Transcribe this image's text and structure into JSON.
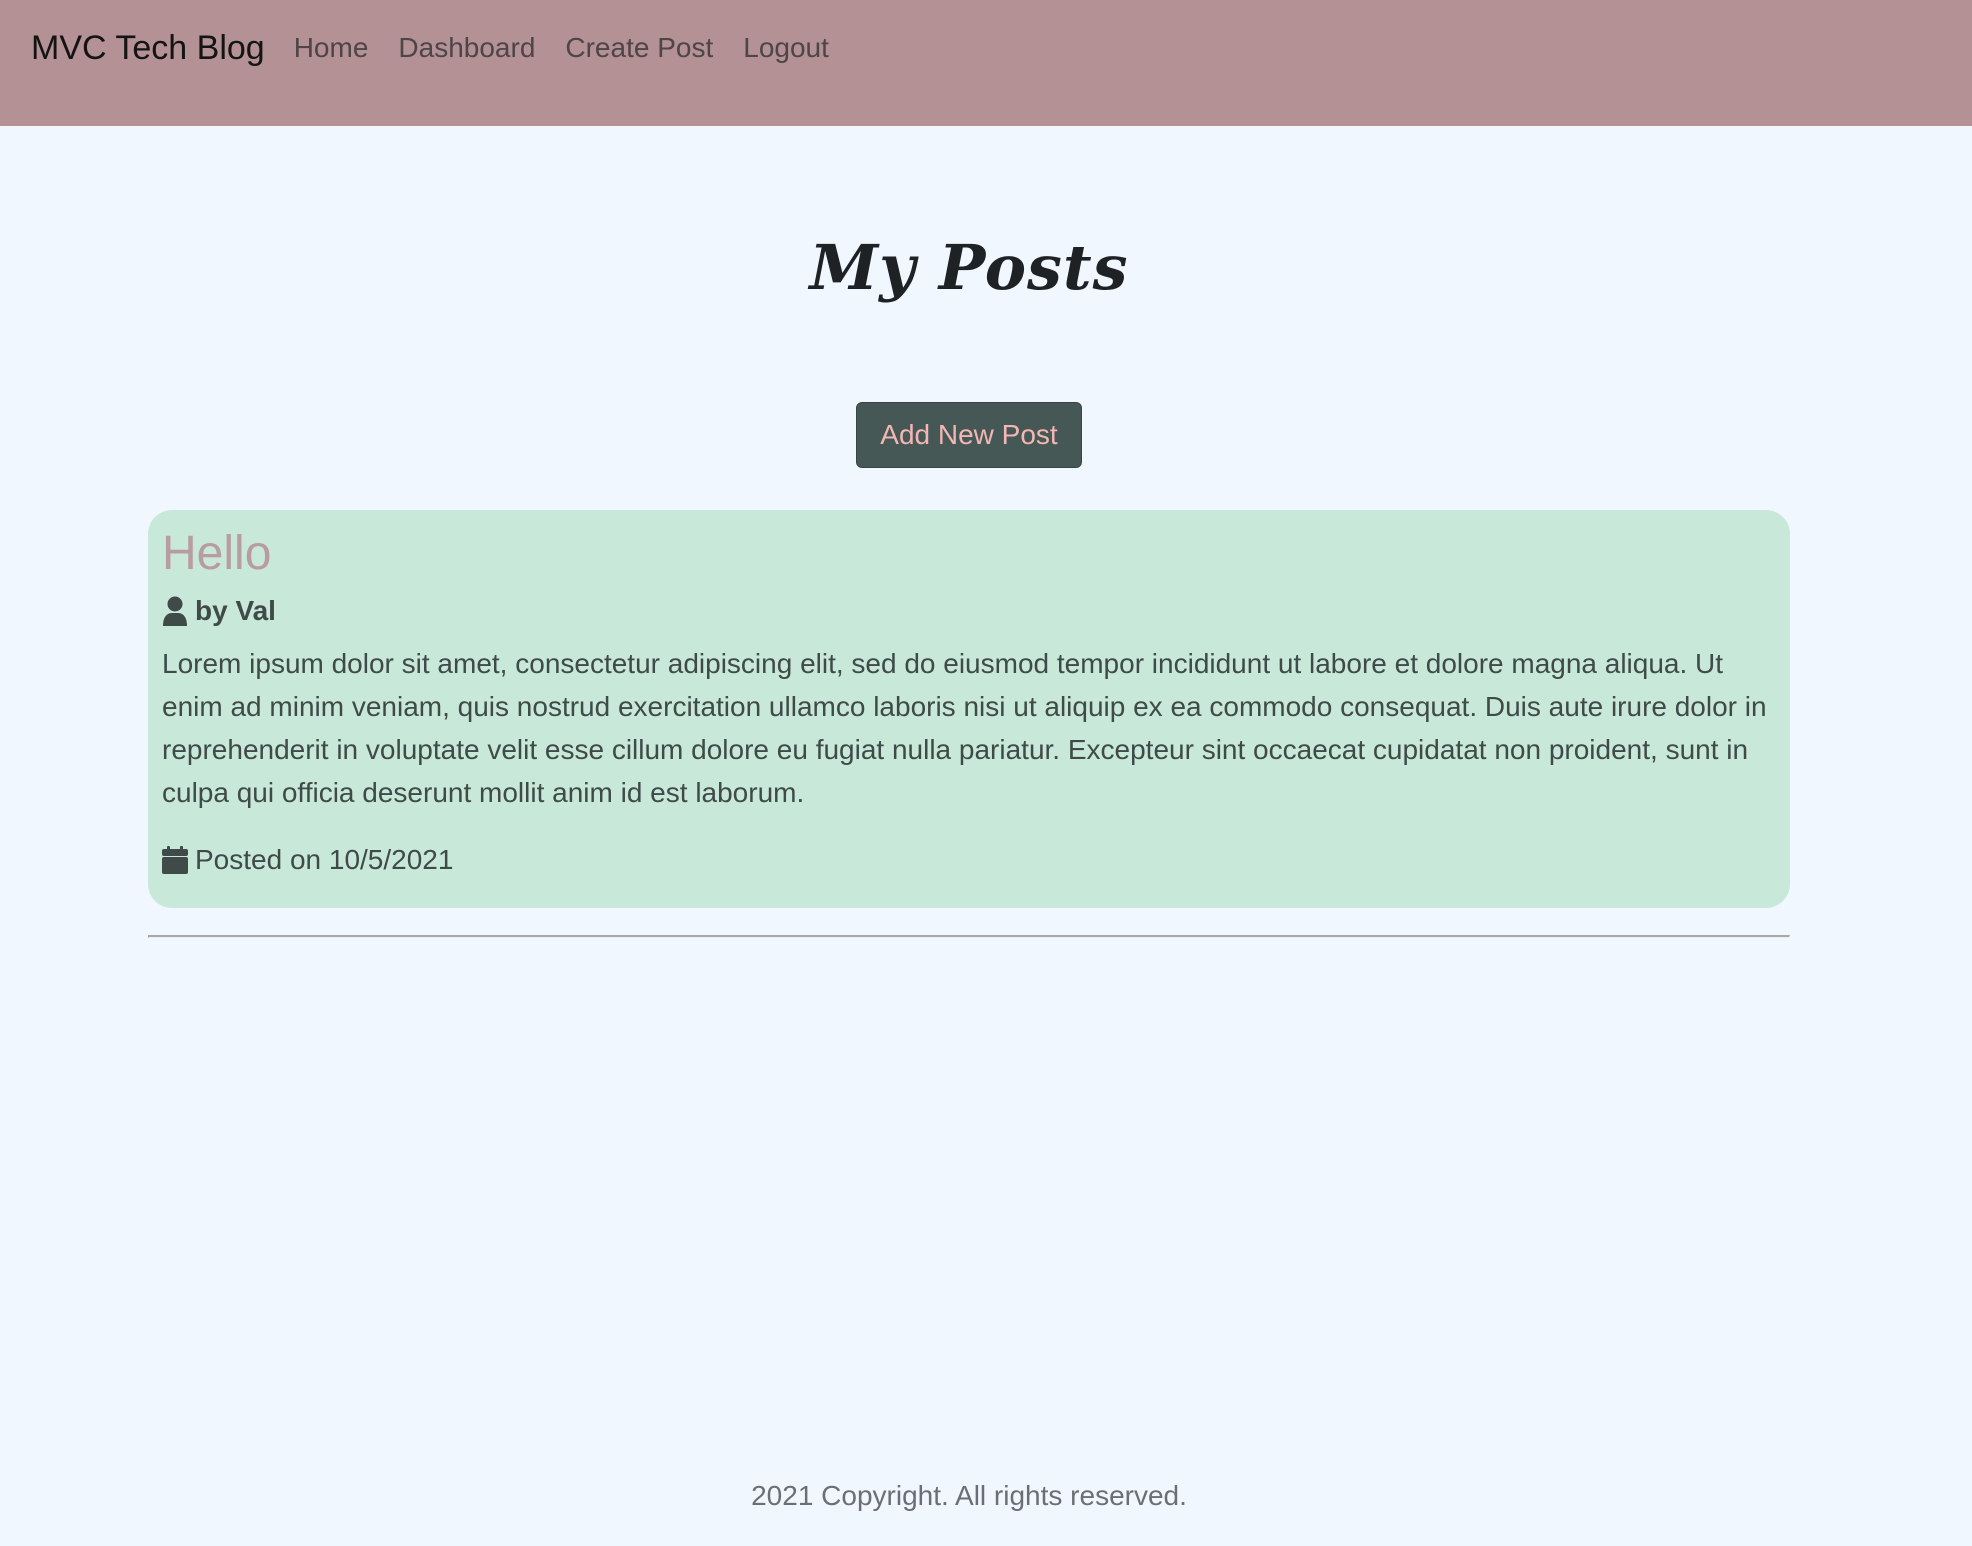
{
  "navbar": {
    "brand": "MVC Tech Blog",
    "links": [
      {
        "label": "Home"
      },
      {
        "label": "Dashboard"
      },
      {
        "label": "Create Post"
      },
      {
        "label": "Logout"
      }
    ],
    "background": "#b49194"
  },
  "main": {
    "title": "My Posts",
    "add_button_label": "Add New Post"
  },
  "posts": [
    {
      "title": "Hello",
      "author": "by Val",
      "author_icon": "user-icon",
      "body": "Lorem ipsum dolor sit amet, consectetur adipiscing elit, sed do eiusmod tempor incididunt ut labore et dolore magna aliqua. Ut enim ad minim veniam, quis nostrud exercitation ullamco laboris nisi ut aliquip ex ea commodo consequat. Duis aute irure dolor in reprehenderit in voluptate velit esse cillum dolore eu fugiat nulla pariatur. Excepteur sint occaecat cupidatat non proident, sunt in culpa qui officia deserunt mollit anim id est laborum.",
      "date": "Posted on 10/5/2021",
      "date_icon": "calendar-icon"
    }
  ],
  "footer": {
    "text": "2021 Copyright. All rights reserved."
  },
  "colors": {
    "page_background": "#f1f7fe",
    "card_background": "#c8e8d9",
    "button_background": "#455856",
    "button_text": "#f2b6b3",
    "post_title": "#b89ca0"
  }
}
